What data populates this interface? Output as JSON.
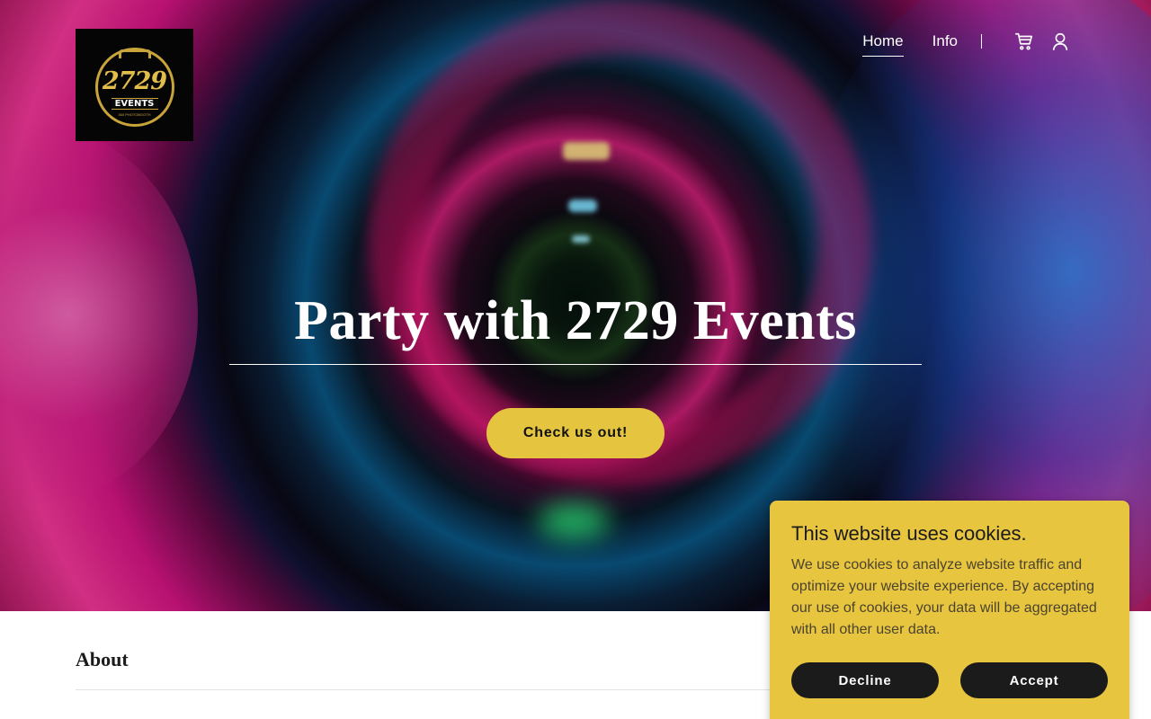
{
  "logo": {
    "number": "2729",
    "word": "EVENTS",
    "tagline": "360 PHOTOBOOTH"
  },
  "nav": {
    "items": [
      {
        "label": "Home",
        "active": true
      },
      {
        "label": "Info",
        "active": false
      }
    ],
    "icons": [
      "cart-icon",
      "user-icon"
    ]
  },
  "hero": {
    "title": "Party with 2729 Events",
    "cta_label": "Check us out!"
  },
  "about": {
    "heading": "About"
  },
  "cookie_banner": {
    "title": "This website uses cookies.",
    "text": "We use cookies to analyze website traffic and optimize your website experience. By accepting our use of cookies, your data will be aggregated with all other user data.",
    "decline_label": "Decline",
    "accept_label": "Accept"
  },
  "colors": {
    "accent_yellow": "#e5c43f",
    "dark_button": "#1b1b1b",
    "white": "#ffffff"
  }
}
